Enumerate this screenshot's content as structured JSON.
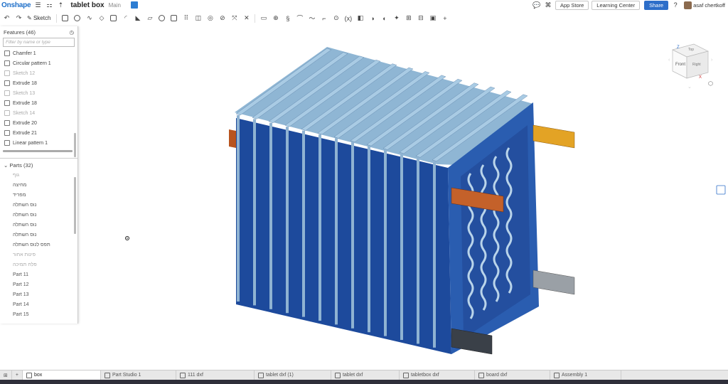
{
  "topbar": {
    "logo": "Onshape",
    "doc_title": "tablet box",
    "workspace": "Main",
    "app_store": "App Store",
    "learning_center": "Learning Center",
    "share": "Share",
    "user": "asaf chertkoff"
  },
  "toolbar": {
    "sketch_label": "Sketch"
  },
  "features": {
    "header": "Features (46)",
    "filter_placeholder": "Filter by name or type",
    "items": [
      {
        "label": "Chamfer 1",
        "dim": false
      },
      {
        "label": "Circular pattern 1",
        "dim": false
      },
      {
        "label": "Sketch 12",
        "dim": true
      },
      {
        "label": "Extrude 18",
        "dim": false
      },
      {
        "label": "Sketch 13",
        "dim": true
      },
      {
        "label": "Extrude 18",
        "dim": false
      },
      {
        "label": "Sketch 14",
        "dim": true
      },
      {
        "label": "Extrude 20",
        "dim": false
      },
      {
        "label": "Extrude 21",
        "dim": false
      },
      {
        "label": "Linear pattern 1",
        "dim": false
      }
    ]
  },
  "parts": {
    "header": "Parts (32)",
    "items": [
      {
        "label": "גוף",
        "dim": true
      },
      {
        "label": "מחיצה",
        "dim": false
      },
      {
        "label": "מפריד",
        "dim": false
      },
      {
        "label": "נוס השתלה",
        "dim": false
      },
      {
        "label": "נוס השתלה",
        "dim": false
      },
      {
        "label": "נוס השתלה",
        "dim": false
      },
      {
        "label": "נוס השתלה",
        "dim": false
      },
      {
        "label": "תפס לנוס השתלה",
        "dim": false
      },
      {
        "label": "פינות אחור",
        "dim": true
      },
      {
        "label": "פלח תמיכה",
        "dim": true
      },
      {
        "label": "Part 11",
        "dim": false
      },
      {
        "label": "Part 12",
        "dim": false
      },
      {
        "label": "Part 13",
        "dim": false
      },
      {
        "label": "Part 14",
        "dim": false
      },
      {
        "label": "Part 15",
        "dim": false
      }
    ]
  },
  "view_cube": {
    "front": "Front",
    "top": "Top",
    "right": "Right",
    "axis_x": "X",
    "axis_z": "Z"
  },
  "tabs": [
    {
      "label": "box",
      "active": true
    },
    {
      "label": "Part Studio 1",
      "active": false
    },
    {
      "label": "111 dxf",
      "active": false
    },
    {
      "label": "tablet dxf (1)",
      "active": false
    },
    {
      "label": "tablet dxf",
      "active": false
    },
    {
      "label": "tabletbox dxf",
      "active": false
    },
    {
      "label": "board dxf",
      "active": false
    },
    {
      "label": "Assembly 1",
      "active": false
    }
  ],
  "colors": {
    "accent": "#2d6ec9",
    "model_dark_blue": "#1d4a9c",
    "model_light_blue": "#9dc3df",
    "orange_tab": "#e3a325",
    "rust_tab": "#b8541f",
    "gray_tab": "#9aa0a6",
    "dark_tab": "#3a4048"
  }
}
